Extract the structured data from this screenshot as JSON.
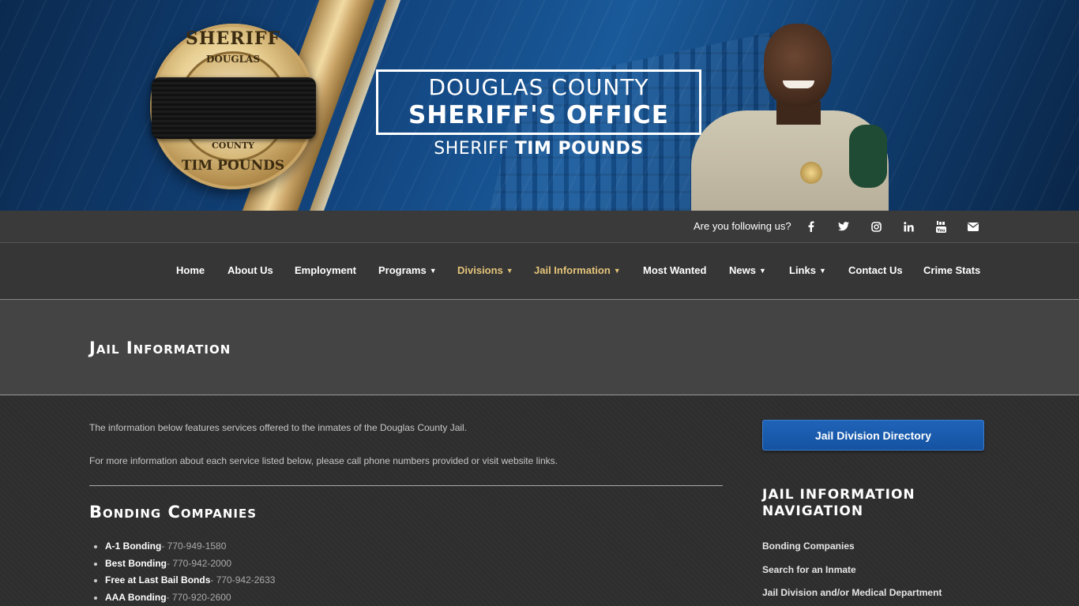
{
  "header": {
    "badge": {
      "top": "SHERIFF",
      "county_name": "DOUGLAS",
      "county_label": "COUNTY",
      "name": "TIM POUNDS"
    },
    "title_line1": "DOUGLAS COUNTY",
    "title_line2": "SHERIFF'S OFFICE",
    "subtitle_prefix": "SHERIFF ",
    "subtitle_name": "TIM POUNDS"
  },
  "social": {
    "label": "Are you following us?",
    "icons": [
      "facebook-icon",
      "twitter-icon",
      "instagram-icon",
      "linkedin-icon",
      "youtube-icon",
      "email-icon"
    ]
  },
  "nav": {
    "items": [
      {
        "label": "Home",
        "dropdown": false
      },
      {
        "label": "About Us",
        "dropdown": false
      },
      {
        "label": "Employment",
        "dropdown": false
      },
      {
        "label": "Programs",
        "dropdown": true
      },
      {
        "label": "Divisions",
        "dropdown": true,
        "highlight": true
      },
      {
        "label": "Jail Information",
        "dropdown": true,
        "highlight": true
      },
      {
        "label": "Most Wanted",
        "dropdown": false
      },
      {
        "label": "News",
        "dropdown": true
      },
      {
        "label": "Links",
        "dropdown": true
      },
      {
        "label": "Contact Us",
        "dropdown": false
      },
      {
        "label": "Crime Stats",
        "dropdown": false
      }
    ],
    "highlight_color": "#e4c479"
  },
  "page": {
    "title": "Jail Information"
  },
  "main": {
    "intro1": "The information below features services offered to the inmates of the Douglas County Jail.",
    "intro2": "For more information about each service listed below, please call phone numbers provided or visit website links.",
    "section_title": "Bonding Companies",
    "bonding_companies": [
      {
        "name": "A-1 Bonding",
        "phone": "- 770-949-1580"
      },
      {
        "name": "Best Bonding",
        "phone": "- 770-942-2000"
      },
      {
        "name": "Free at Last Bail Bonds",
        "phone": "- 770-942-2633"
      },
      {
        "name": "AAA Bonding",
        "phone": "- 770-920-2600"
      }
    ]
  },
  "sidebar": {
    "button_label": "Jail Division Directory",
    "nav_title": "Jail Information Navigation",
    "links": [
      "Bonding Companies",
      "Search for an Inmate",
      "Jail Division and/or Medical Department"
    ]
  }
}
